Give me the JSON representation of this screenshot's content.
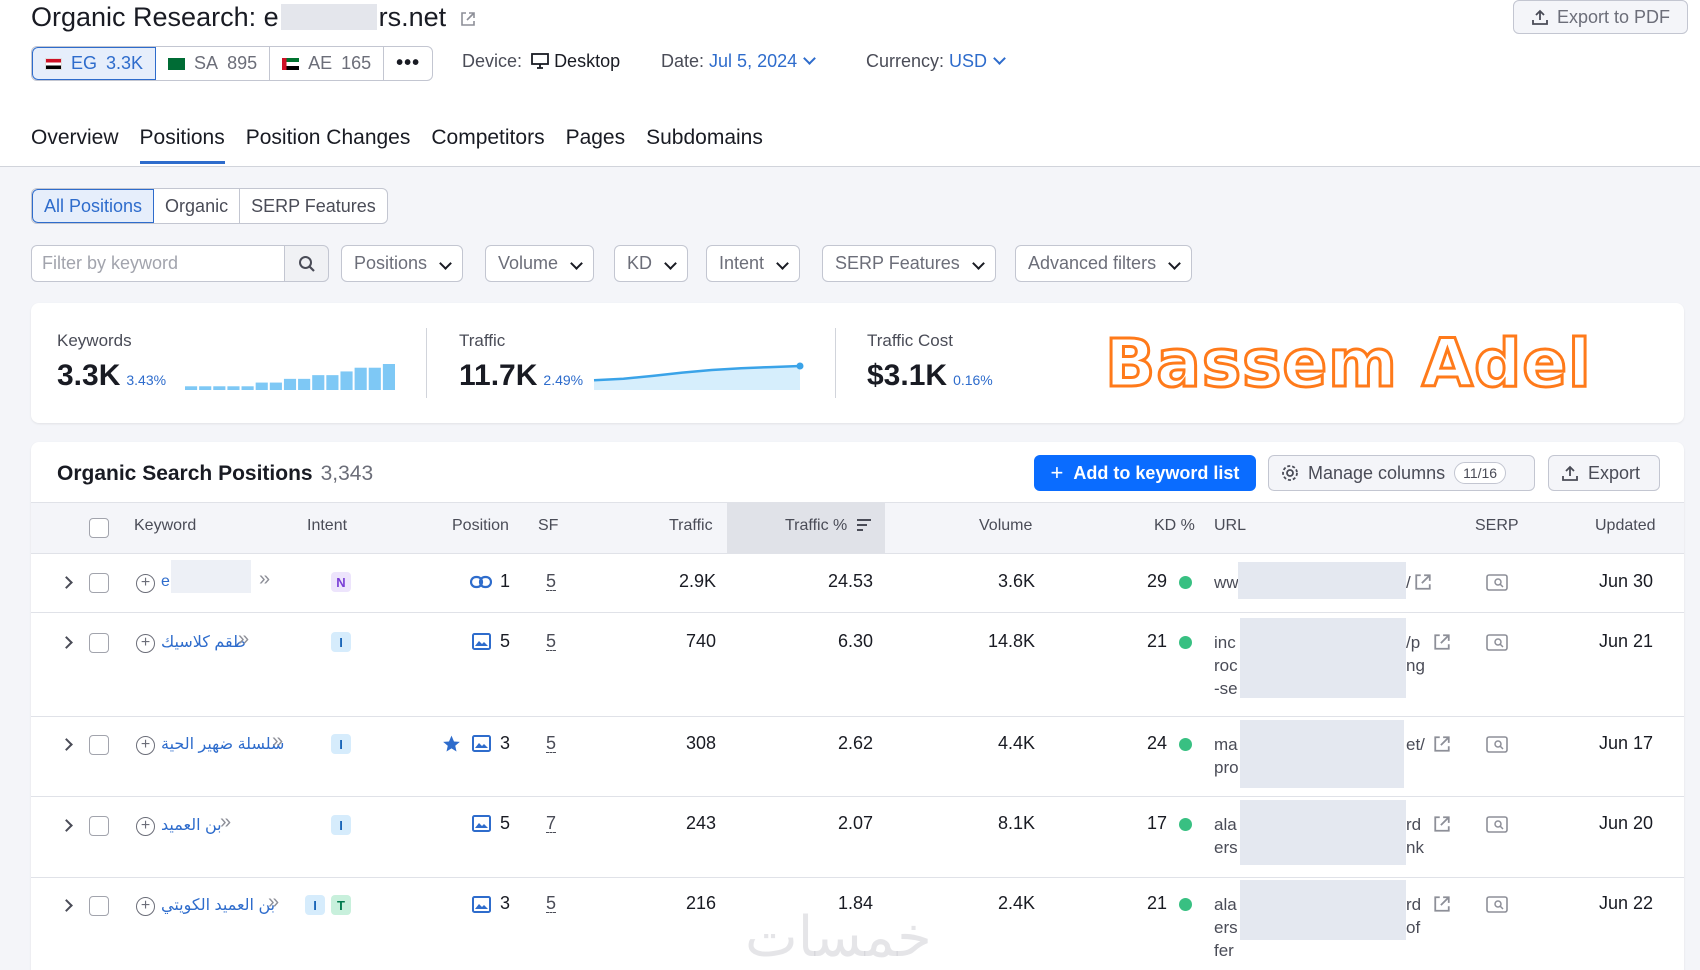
{
  "header": {
    "title_prefix": "Organic Research: e",
    "title_suffix": "rs.net",
    "export_pdf": "Export to PDF",
    "databases": [
      {
        "code": "EG",
        "value": "3.3K"
      },
      {
        "code": "SA",
        "value": "895"
      },
      {
        "code": "AE",
        "value": "165"
      }
    ],
    "more": "•••",
    "device_label": "Device:",
    "device_value": "Desktop",
    "date_label": "Date:",
    "date_value": "Jul 5, 2024",
    "currency_label": "Currency:",
    "currency_value": "USD"
  },
  "tabs": [
    "Overview",
    "Positions",
    "Position Changes",
    "Competitors",
    "Pages",
    "Subdomains"
  ],
  "active_tab": "Positions",
  "segments": [
    "All Positions",
    "Organic",
    "SERP Features"
  ],
  "filters": {
    "placeholder": "Filter by keyword",
    "dropdowns": [
      "Positions",
      "Volume",
      "KD",
      "Intent",
      "SERP Features",
      "Advanced filters"
    ]
  },
  "summary": {
    "keywords": {
      "label": "Keywords",
      "value": "3.3K",
      "delta": "3.43%"
    },
    "traffic": {
      "label": "Traffic",
      "value": "11.7K",
      "delta": "2.49%"
    },
    "traffic_cost": {
      "label": "Traffic Cost",
      "value": "$3.1K",
      "delta": "0.16%"
    },
    "keywords_trend": [
      1,
      1,
      1,
      1,
      1,
      2,
      2,
      3,
      3,
      4,
      4,
      5,
      6,
      6,
      7
    ],
    "traffic_trend": [
      0.35,
      0.42,
      0.55,
      0.7,
      0.82,
      0.9,
      0.95,
      1.0
    ],
    "watermark": "Bassem Adel"
  },
  "table": {
    "title": "Organic Search Positions",
    "count": "3,343",
    "add_button": "Add to keyword list",
    "manage_columns": "Manage columns",
    "columns_count": "11/16",
    "export": "Export",
    "headers": {
      "keyword": "Keyword",
      "intent": "Intent",
      "position": "Position",
      "sf": "SF",
      "traffic": "Traffic",
      "traffic_pct": "Traffic %",
      "volume": "Volume",
      "kd": "KD %",
      "url": "URL",
      "serp": "SERP",
      "updated": "Updated"
    },
    "rows": [
      {
        "keyword": "e",
        "intent": [
          "N"
        ],
        "position": "1",
        "pos_icon": "link",
        "sf": "5",
        "traffic": "2.9K",
        "traffic_pct": "24.53",
        "volume": "3.6K",
        "kd": "29",
        "url_start": [
          "ww"
        ],
        "url_end": [
          "/"
        ],
        "updated": "Jun 30"
      },
      {
        "keyword": "طقم كلاسيك",
        "intent": [
          "I"
        ],
        "position": "5",
        "pos_icon": "image",
        "sf": "5",
        "traffic": "740",
        "traffic_pct": "6.30",
        "volume": "14.8K",
        "kd": "21",
        "url_start": [
          "inc",
          "roc",
          "-se"
        ],
        "url_end": [
          "/p",
          "ng"
        ],
        "updated": "Jun 21"
      },
      {
        "keyword": "سلسلة ضهير الحية",
        "intent": [
          "I"
        ],
        "position": "3",
        "pos_icon": "image",
        "star": true,
        "sf": "5",
        "traffic": "308",
        "traffic_pct": "2.62",
        "volume": "4.4K",
        "kd": "24",
        "url_start": [
          "ma",
          "pro"
        ],
        "url_end": [
          "et/"
        ],
        "updated": "Jun 17"
      },
      {
        "keyword": "بن العميد",
        "intent": [
          "I"
        ],
        "position": "5",
        "pos_icon": "image",
        "sf": "7",
        "traffic": "243",
        "traffic_pct": "2.07",
        "volume": "8.1K",
        "kd": "17",
        "url_start": [
          "ala",
          "ers"
        ],
        "url_end": [
          "rd",
          "nk"
        ],
        "updated": "Jun 20"
      },
      {
        "keyword": "بن العميد الكويتي",
        "intent": [
          "I",
          "T"
        ],
        "position": "3",
        "pos_icon": "image",
        "sf": "5",
        "traffic": "216",
        "traffic_pct": "1.84",
        "volume": "2.4K",
        "kd": "21",
        "url_start": [
          "ala",
          "ers",
          "fer"
        ],
        "url_end": [
          "rd",
          "of"
        ],
        "updated": "Jun 22"
      }
    ]
  },
  "colors": {
    "accent": "#2e6ccc",
    "primary_button": "#0a6cff",
    "kd_dot": "#38c082",
    "watermark": "#ff7a1a"
  },
  "site_watermark": "خمسات"
}
